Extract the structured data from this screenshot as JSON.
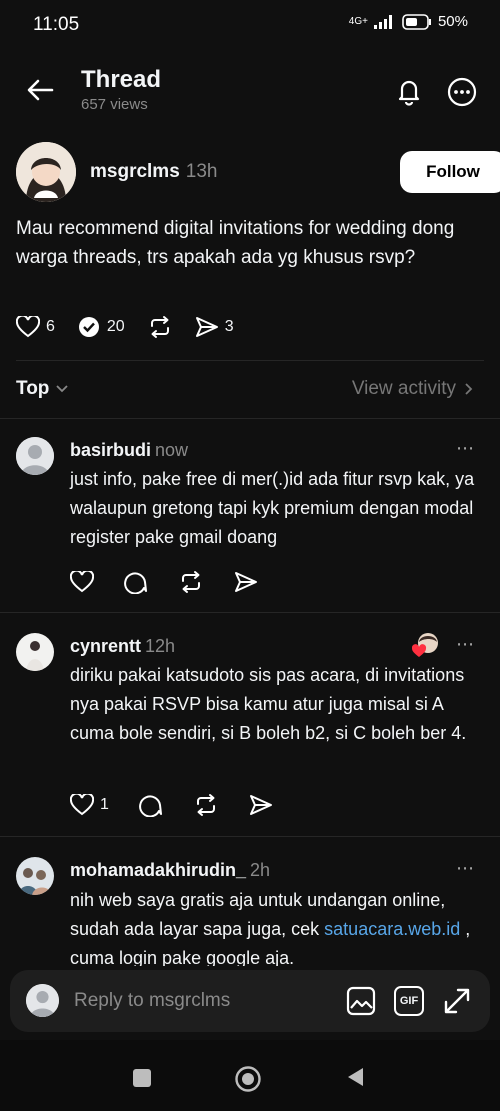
{
  "status_bar": {
    "time": "11:05",
    "battery": "50%",
    "network": "4G+"
  },
  "header": {
    "title": "Thread",
    "views": "657 views"
  },
  "post": {
    "username": "msgrclms",
    "time": "13h",
    "follow_label": "Follow",
    "text": "Mau recommend digital invitations for wedding dong warga threads, trs apakah ada yg khusus rsvp?",
    "likes": "6",
    "reposts": "20",
    "shares": "3"
  },
  "sort": {
    "label": "Top",
    "view_activity": "View activity"
  },
  "replies": [
    {
      "username": "basirbudi",
      "time": "now",
      "text": "just info, pake free di mer(.)id ada fitur rsvp kak, ya walaupun gretong tapi kyk premium dengan modal register pake gmail doang",
      "likes": ""
    },
    {
      "username": "cynrentt",
      "time": "12h",
      "text": "diriku pakai katsudoto sis pas acara, di invitations nya pakai RSVP bisa kamu atur juga misal si A cuma bole sendiri, si B boleh b2, si C boleh ber 4.",
      "likes": "1"
    },
    {
      "username": "mohamadakhirudin_",
      "time": "2h",
      "text_before": "nih web saya gratis aja untuk undangan online, sudah ada layar sapa  juga, cek ",
      "link": "satuacara.web.id",
      "text_after": " , cuma login pake google aja."
    }
  ],
  "composer": {
    "placeholder": "Reply to msgrclms",
    "gif_label": "GIF"
  },
  "icons": {
    "more": "⋯"
  }
}
